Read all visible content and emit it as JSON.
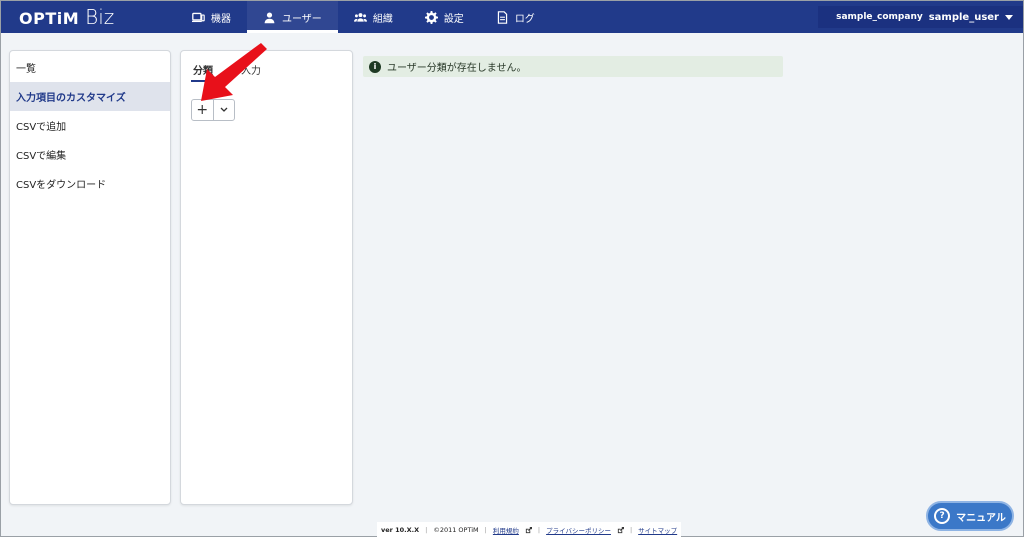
{
  "header": {
    "logo_main": "OPTiM",
    "logo_sub": "Biz",
    "nav": [
      {
        "label": "機器",
        "icon": "device-icon"
      },
      {
        "label": "ユーザー",
        "icon": "user-icon"
      },
      {
        "label": "組織",
        "icon": "group-icon"
      },
      {
        "label": "設定",
        "icon": "gear-icon"
      },
      {
        "label": "ログ",
        "icon": "document-icon"
      }
    ],
    "company": "sample_company",
    "user": "sample_user"
  },
  "sidebar": {
    "items": [
      {
        "label": "一覧"
      },
      {
        "label": "入力項目のカスタマイズ"
      },
      {
        "label": "CSVで追加"
      },
      {
        "label": "CSVで編集"
      },
      {
        "label": "CSVをダウンロード"
      }
    ]
  },
  "middle": {
    "tabs": [
      {
        "label": "分類"
      },
      {
        "label": "入力"
      }
    ],
    "add_button": "+"
  },
  "banner": {
    "message": "ユーザー分類が存在しません。"
  },
  "footer": {
    "version": "ver 10.X.X",
    "copyright": "©2011 OPTiM",
    "terms": "利用規約",
    "privacy": "プライバシーポリシー",
    "sitemap": "サイトマップ"
  },
  "manual_button": {
    "label": "マニュアル"
  },
  "colors": {
    "header_bg": "#213a8a",
    "banner_bg": "#e3ede3",
    "manual_bg": "#3b78c8",
    "arrow": "#e8101a"
  }
}
